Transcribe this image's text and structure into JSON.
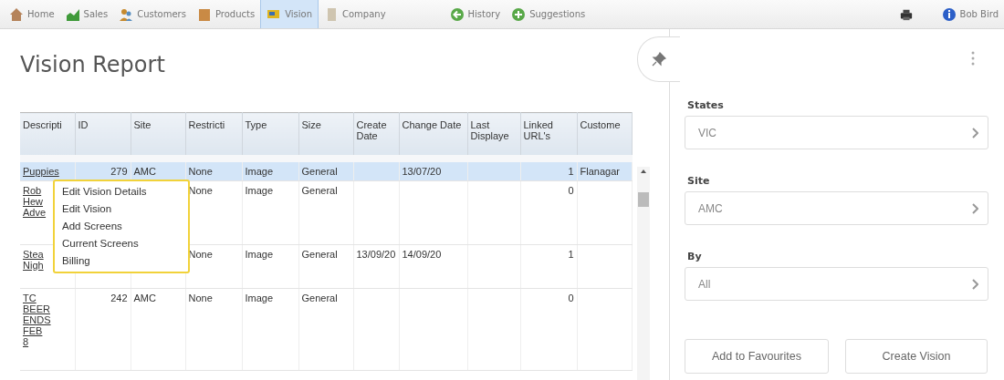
{
  "nav": {
    "items": [
      {
        "label": "Home",
        "selected": false
      },
      {
        "label": "Sales",
        "selected": false
      },
      {
        "label": "Customers",
        "selected": false
      },
      {
        "label": "Products",
        "selected": false
      },
      {
        "label": "Vision",
        "selected": true
      },
      {
        "label": "Company",
        "selected": false
      }
    ],
    "actions": [
      {
        "label": "History"
      },
      {
        "label": "Suggestions"
      }
    ],
    "user": "Bob Bird"
  },
  "page": {
    "title": "Vision Report"
  },
  "table": {
    "columns": [
      {
        "label": "Descripti",
        "kind": "link"
      },
      {
        "label": "ID",
        "kind": "number"
      },
      {
        "label": "Site",
        "kind": "text"
      },
      {
        "label": "Restricti",
        "kind": "text"
      },
      {
        "label": "Type",
        "kind": "text"
      },
      {
        "label": "Size",
        "kind": "text"
      },
      {
        "label": "Create Date",
        "kind": "text"
      },
      {
        "label": "Change Date",
        "kind": "text"
      },
      {
        "label": "Last Displaye",
        "kind": "text"
      },
      {
        "label": "Linked URL's",
        "kind": "number"
      },
      {
        "label": "Custome",
        "kind": "text"
      }
    ],
    "rows": [
      {
        "selected": true,
        "cells": [
          "Puppies",
          "279",
          "AMC",
          "None",
          "Image",
          "General",
          "",
          "13/07/20",
          "",
          "1",
          "Flanagar"
        ]
      },
      {
        "selected": false,
        "cells": [
          "Rob Hew Adve",
          "",
          "",
          "None",
          "Image",
          "General",
          "",
          "",
          "",
          "0",
          ""
        ]
      },
      {
        "selected": false,
        "cells": [
          "Stea Nigh",
          "",
          "",
          "None",
          "Image",
          "General",
          "13/09/20",
          "14/09/20",
          "",
          "1",
          ""
        ]
      },
      {
        "selected": false,
        "cells": [
          "TC BEER ENDS FEB 8",
          "242",
          "AMC",
          "None",
          "Image",
          "General",
          "",
          "",
          "",
          "0",
          ""
        ]
      }
    ]
  },
  "context_menu": {
    "items": [
      "Edit Vision Details",
      "Edit Vision",
      "Add Screens",
      "Current Screens",
      "Billing"
    ]
  },
  "filters": [
    {
      "label": "States",
      "value": "VIC"
    },
    {
      "label": "Site",
      "value": "AMC"
    },
    {
      "label": "By",
      "value": "All"
    }
  ],
  "buttons": [
    "Add to Favourites",
    "Create Vision"
  ]
}
